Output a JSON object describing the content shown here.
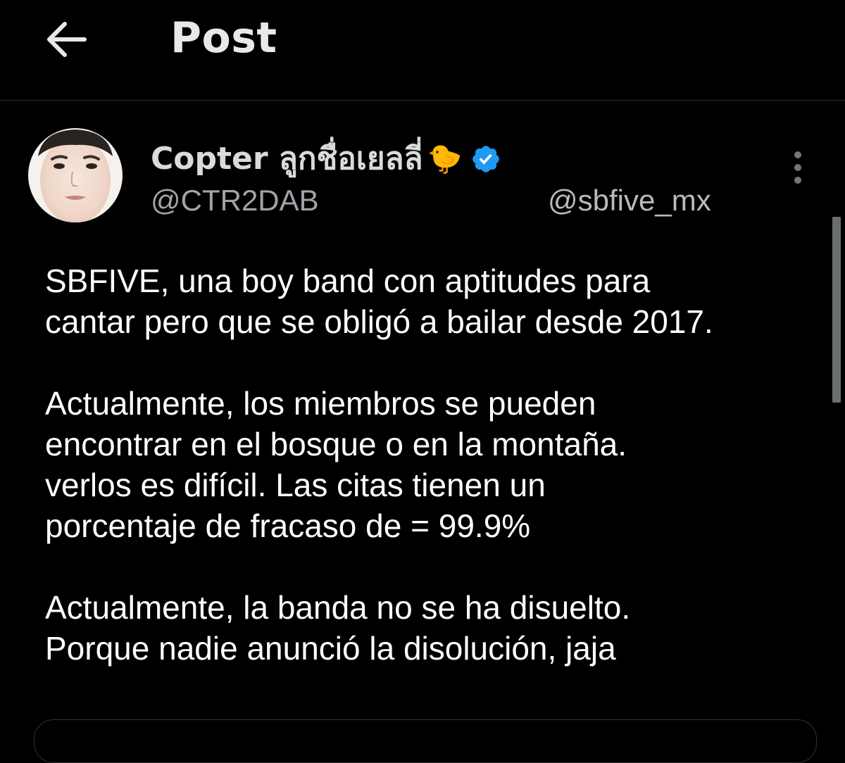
{
  "header": {
    "title": "Post",
    "back_icon": "arrow-left-icon"
  },
  "author": {
    "display_name": "Copter ลูกชื่อเยลลี่",
    "name_emoji": "🐤",
    "verified_icon": "verified-badge-icon",
    "handle": "@CTR2DAB"
  },
  "watermark": "@sbfive_mx",
  "post": {
    "paragraphs": [
      "SBFIVE, una boy band con aptitudes para\ncantar pero que se obligó a bailar desde 2017.",
      "Actualmente, los miembros se pueden\nencontrar en el bosque o en la montaña.\nverlos es difícil. Las citas tienen un\nporcentaje de fracaso de = 99.9%",
      "Actualmente, la banda no se ha disuelto.\nPorque nadie anunció la disolución, jaja"
    ]
  },
  "colors": {
    "background": "#000000",
    "text": "#ffffff",
    "secondary_text": "#a0a4a8",
    "verified_blue": "#1d9bf0",
    "divider": "#2f3336"
  }
}
